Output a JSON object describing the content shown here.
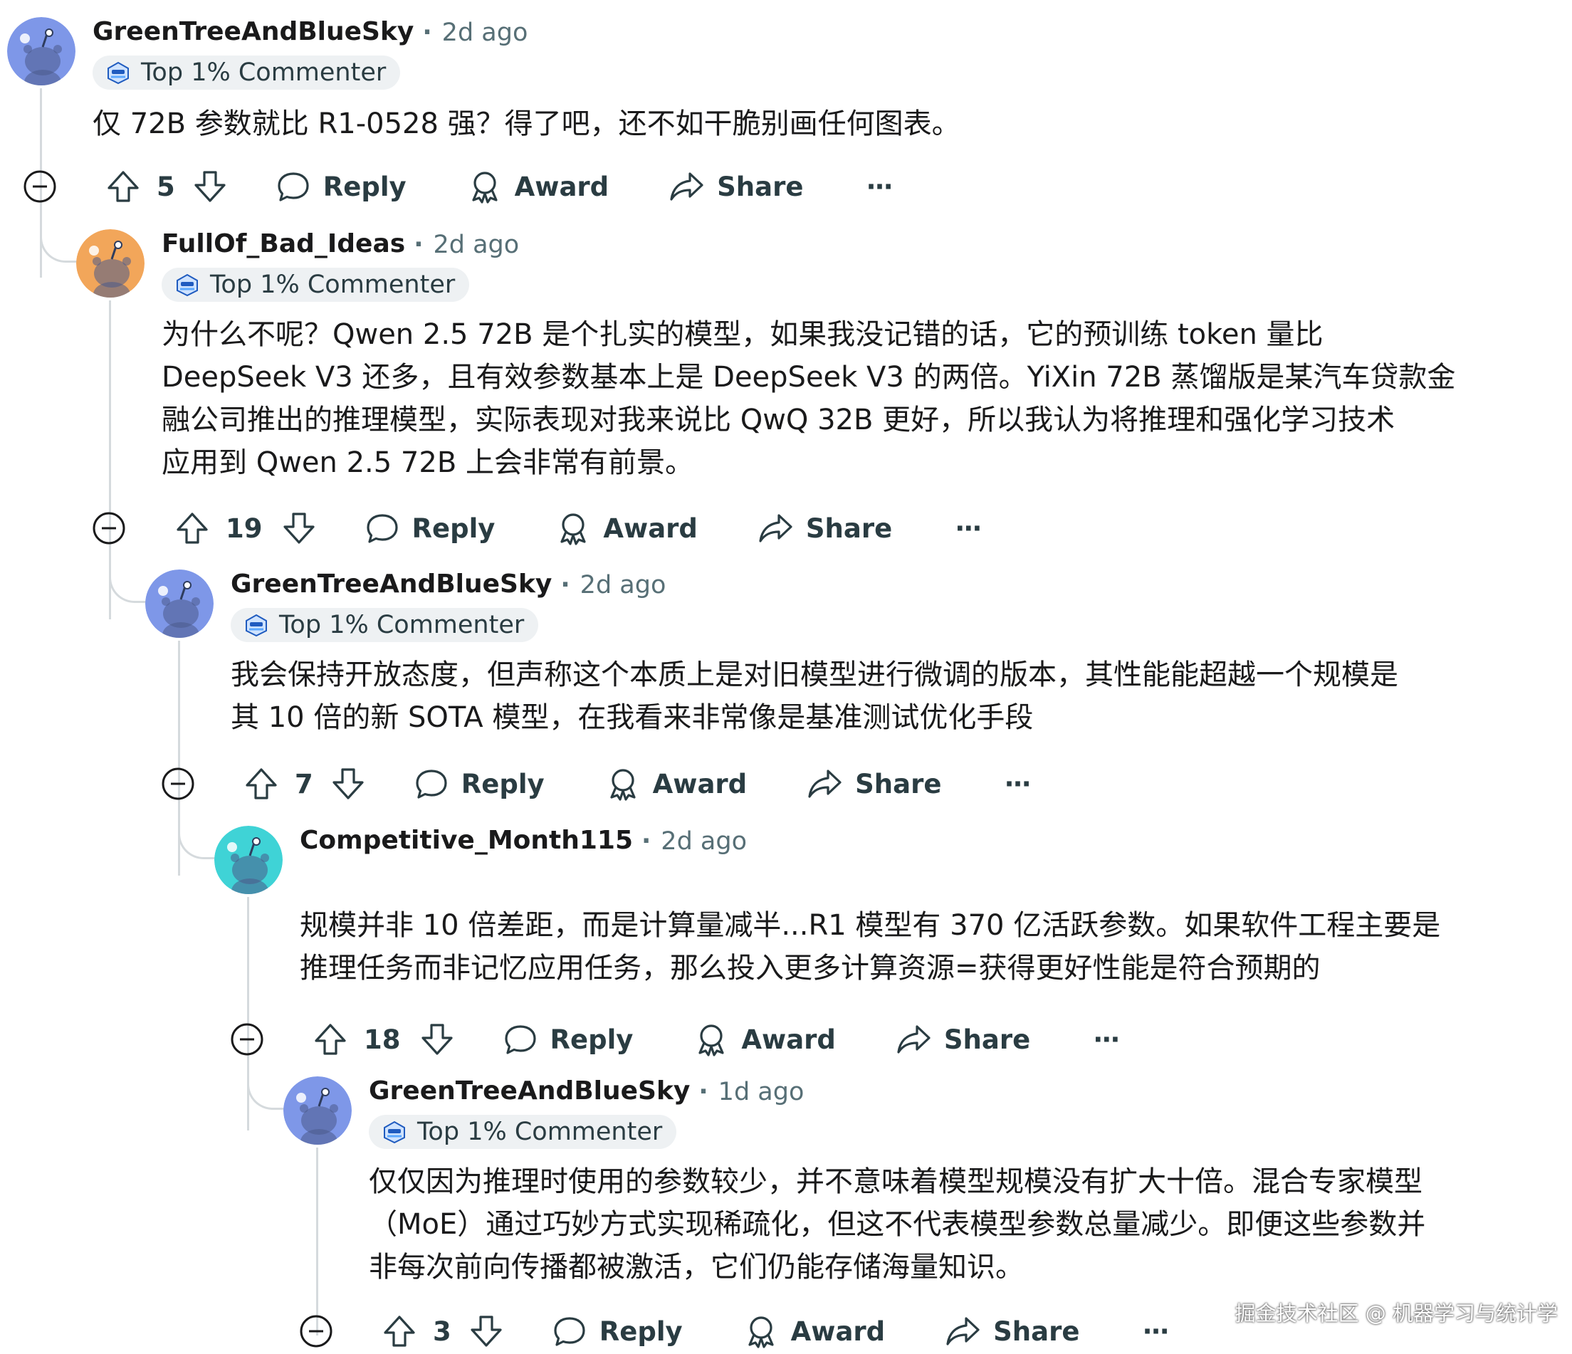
{
  "accent_colors": {
    "avatar_blue": "#7e97e8",
    "avatar_orange": "#f2a65a",
    "avatar_cyan": "#3fd3d6",
    "thread_line": "#d5dadd",
    "meta_text": "#576f76"
  },
  "action_labels": {
    "reply": "Reply",
    "award": "Award",
    "share": "Share",
    "more": "···"
  },
  "comments": [
    {
      "username": "GreenTreeAndBlueSky",
      "age": "2d ago",
      "badge": "Top 1% Commenter",
      "lines": [
        "仅 72B 参数就比 R1-0528 强？得了吧，还不如干脆别画任何图表。"
      ],
      "votes": "5",
      "avatar_color": "#7e97e8",
      "avatar_icon": "snoo-avatar"
    },
    {
      "username": "FullOf_Bad_Ideas",
      "age": "2d ago",
      "badge": "Top 1% Commenter",
      "lines": [
        "为什么不呢？Qwen 2.5 72B 是个扎实的模型，如果我没记错的话，它的预训练 token 量比",
        "DeepSeek V3 还多，且有效参数基本上是 DeepSeek V3 的两倍。YiXin 72B 蒸馏版是某汽车贷款金",
        "融公司推出的推理模型，实际表现对我来说比 QwQ 32B 更好，所以我认为将推理和强化学习技术",
        "应用到 Qwen 2.5 72B 上会非常有前景。"
      ],
      "votes": "19",
      "avatar_color": "#f2a65a",
      "avatar_icon": "snoo-avatar"
    },
    {
      "username": "GreenTreeAndBlueSky",
      "age": "2d ago",
      "badge": "Top 1% Commenter",
      "lines": [
        "我会保持开放态度，但声称这个本质上是对旧模型进行微调的版本，其性能能超越一个规模是",
        "其 10 倍的新 SOTA 模型，在我看来非常像是基准测试优化手段"
      ],
      "votes": "7",
      "avatar_color": "#7e97e8",
      "avatar_icon": "snoo-avatar"
    },
    {
      "username": "Competitive_Month115",
      "age": "2d ago",
      "badge": "",
      "lines": [
        "规模并非 10 倍差距，而是计算量减半...R1 模型有 370 亿活跃参数。如果软件工程主要是",
        "推理任务而非记忆应用任务，那么投入更多计算资源=获得更好性能是符合预期的"
      ],
      "votes": "18",
      "avatar_color": "#3fd3d6",
      "avatar_icon": "snoo-avatar"
    },
    {
      "username": "GreenTreeAndBlueSky",
      "age": "1d ago",
      "badge": "Top 1% Commenter",
      "lines": [
        "仅仅因为推理时使用的参数较少，并不意味着模型规模没有扩大十倍。混合专家模型",
        "（MoE）通过巧妙方式实现稀疏化，但这不代表模型参数总量减少。即便这些参数并",
        "非每次前向传播都被激活，它们仍能存储海量知识。"
      ],
      "votes": "3",
      "avatar_color": "#7e97e8",
      "avatar_icon": "snoo-avatar"
    }
  ],
  "watermark": "掘金技术社区 @ 机器学习与统计学"
}
